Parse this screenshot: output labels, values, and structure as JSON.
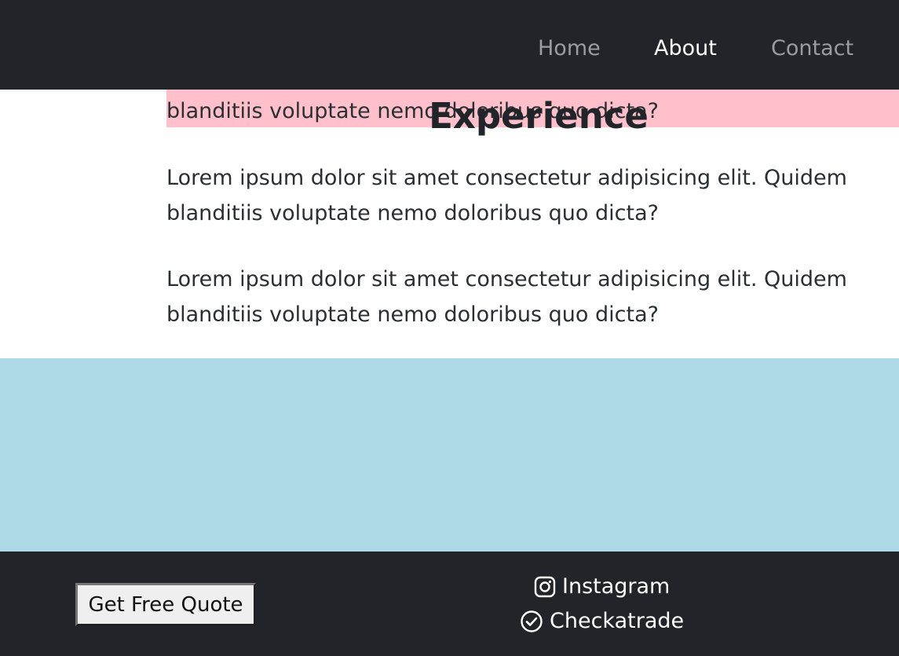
{
  "nav": {
    "items": [
      {
        "label": "Home"
      },
      {
        "label": "About"
      },
      {
        "label": "Contact"
      }
    ]
  },
  "content": {
    "cutoff_line": "blanditiis voluptate nemo doloribus quo dicta?",
    "heading": "Experience",
    "paragraph_1": {
      "line_1": "Lorem ipsum dolor sit amet consectetur adipisicing elit. Quidem",
      "line_2": "blanditiis voluptate nemo doloribus quo dicta?"
    },
    "paragraph_2": {
      "line_1": "Lorem ipsum dolor sit amet consectetur adipisicing elit. Quidem",
      "line_2": "blanditiis voluptate nemo doloribus quo dicta?"
    }
  },
  "footer": {
    "quote_button": "Get Free Quote",
    "instagram": {
      "label": "Instagram",
      "icon": "instagram-icon"
    },
    "checkatrade": {
      "label": "Checkatrade",
      "icon": "check-circle-icon"
    }
  },
  "colors": {
    "dark": "#212529",
    "highlight": "#ffc0cb",
    "section": "#add8e6",
    "nav_inactive": "#9a9da0"
  }
}
